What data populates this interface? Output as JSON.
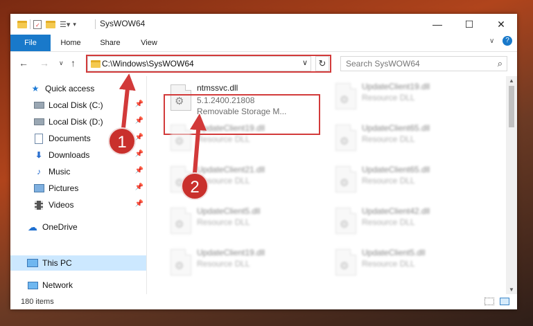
{
  "window": {
    "title": "SysWOW64"
  },
  "titlebar": {
    "minimize": "—",
    "maximize": "☐",
    "close": "✕"
  },
  "ribbon": {
    "tabs": [
      "File",
      "Home",
      "Share",
      "View"
    ],
    "expand": "∨",
    "help": "?"
  },
  "navigation": {
    "back": "←",
    "forward": "→",
    "recent": "∨",
    "up": "↑",
    "address": "C:\\Windows\\SysWOW64",
    "address_dropdown": "∨",
    "refresh": "↻",
    "search_placeholder": "Search SysWOW64",
    "search_icon": "⌕"
  },
  "sidebar": {
    "items": [
      {
        "label": "Quick access",
        "icon": "star-icon",
        "pinned": false
      },
      {
        "label": "Local Disk (C:)",
        "icon": "drive-icon",
        "pinned": true
      },
      {
        "label": "Local Disk (D:)",
        "icon": "drive-icon",
        "pinned": true
      },
      {
        "label": "Documents",
        "icon": "documents-icon",
        "pinned": true
      },
      {
        "label": "Downloads",
        "icon": "downloads-icon",
        "pinned": true
      },
      {
        "label": "Music",
        "icon": "music-icon",
        "pinned": true
      },
      {
        "label": "Pictures",
        "icon": "pictures-icon",
        "pinned": true
      },
      {
        "label": "Videos",
        "icon": "videos-icon",
        "pinned": true
      },
      {
        "label": "OneDrive",
        "icon": "cloud-icon",
        "pinned": false
      },
      {
        "label": "This PC",
        "icon": "computer-icon",
        "pinned": false,
        "selected": true
      },
      {
        "label": "Network",
        "icon": "network-icon",
        "pinned": false
      }
    ]
  },
  "files": {
    "highlighted": {
      "name": "ntmssvc.dll",
      "version": "5.1.2400.21808",
      "description": "Removable Storage M..."
    },
    "left_column": [
      {
        "name": "UpdateClient19.dll",
        "type": "Resource DLL"
      },
      {
        "name": "UpdateClient21.dll",
        "type": "Resource DLL"
      },
      {
        "name": "UpdateClient5.dll",
        "type": "Resource DLL"
      },
      {
        "name": "UpdateClient19.dll",
        "type": "Resource DLL"
      }
    ],
    "right_column": [
      {
        "name": "UpdateClient19.dll",
        "type": "Resource DLL"
      },
      {
        "name": "UpdateClient65.dll",
        "type": "Resource DLL"
      },
      {
        "name": "UpdateClient65.dll",
        "type": "Resource DLL"
      },
      {
        "name": "UpdateClient42.dll",
        "type": "Resource DLL"
      },
      {
        "name": "UpdateClient5.dll",
        "type": "Resource DLL"
      }
    ]
  },
  "status": {
    "item_count": "180 items"
  },
  "callouts": {
    "step1": "1",
    "step2": "2"
  },
  "colors": {
    "accent": "#1979ca",
    "highlight": "#d23a3a",
    "selection": "#cce8ff"
  }
}
